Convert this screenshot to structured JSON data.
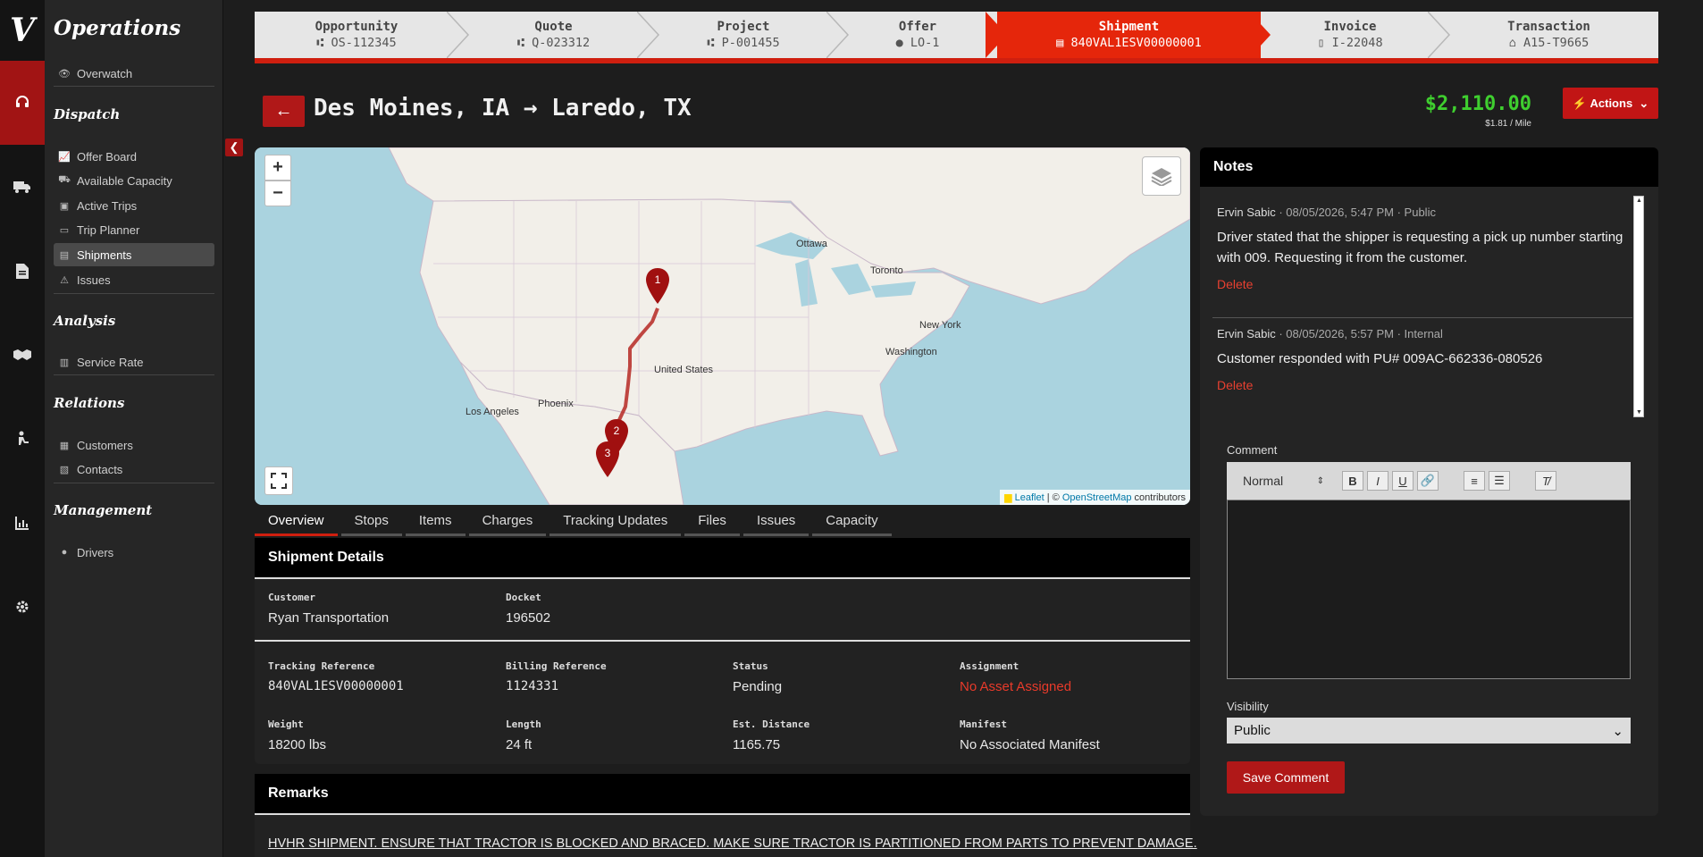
{
  "app": {
    "logo_letter": "V",
    "title": "Operations"
  },
  "rail": [
    {
      "icon": "headset-icon",
      "active": true
    },
    {
      "icon": "truck-icon",
      "active": false
    },
    {
      "icon": "document-icon",
      "active": false
    },
    {
      "icon": "handshake-icon",
      "active": false
    },
    {
      "icon": "person-carry-icon",
      "active": false
    },
    {
      "icon": "chart-icon",
      "active": false
    },
    {
      "icon": "gear-icon",
      "active": false
    }
  ],
  "nav": {
    "overwatch": "Overwatch",
    "sections": {
      "dispatch": "Dispatch",
      "analysis": "Analysis",
      "relations": "Relations",
      "management": "Management"
    },
    "items": {
      "offer_board": "Offer Board",
      "available_capacity": "Available Capacity",
      "active_trips": "Active Trips",
      "trip_planner": "Trip Planner",
      "shipments": "Shipments",
      "issues": "Issues",
      "service_rate": "Service Rate",
      "customers": "Customers",
      "contacts": "Contacts",
      "drivers": "Drivers"
    }
  },
  "breadcrumb": [
    {
      "label": "Opportunity",
      "value": "OS-112345",
      "icon": "flow-icon"
    },
    {
      "label": "Quote",
      "value": "Q-023312",
      "icon": "flow-icon"
    },
    {
      "label": "Project",
      "value": "P-001455",
      "icon": "flow-icon"
    },
    {
      "label": "Offer",
      "value": "LO-1",
      "icon": "chat-icon"
    },
    {
      "label": "Shipment",
      "value": "840VAL1ESV00000001",
      "icon": "box-icon",
      "active": true
    },
    {
      "label": "Invoice",
      "value": "I-22048",
      "icon": "document-icon"
    },
    {
      "label": "Transaction",
      "value": "A15-T9665",
      "icon": "bank-icon"
    }
  ],
  "header": {
    "back": "←",
    "route": "Des Moines, IA → Laredo, TX",
    "price": "$2,110.00",
    "per_mile": "$1.81 / Mile",
    "actions": "Actions"
  },
  "map": {
    "zoom_in": "+",
    "zoom_out": "−",
    "labels": {
      "ottawa": "Ottawa",
      "toronto": "Toronto",
      "new_york": "New York",
      "washington": "Washington",
      "united_states": "United States",
      "phoenix": "Phoenix",
      "los_angeles": "Los Angeles"
    },
    "markers": [
      "1",
      "2",
      "3"
    ],
    "attribution": {
      "leaflet": "Leaflet",
      "sep": " | © ",
      "osm": "OpenStreetMap",
      "suffix": " contributors"
    }
  },
  "tabs": [
    "Overview",
    "Stops",
    "Items",
    "Charges",
    "Tracking Updates",
    "Files",
    "Issues",
    "Capacity"
  ],
  "details": {
    "title": "Shipment Details",
    "customer": {
      "label": "Customer",
      "value": "Ryan Transportation"
    },
    "docket": {
      "label": "Docket",
      "value": "196502"
    },
    "tracking": {
      "label": "Tracking Reference",
      "value": "840VAL1ESV00000001"
    },
    "billing": {
      "label": "Billing Reference",
      "value": "1124331"
    },
    "status": {
      "label": "Status",
      "value": "Pending"
    },
    "assignment": {
      "label": "Assignment",
      "value": "No Asset Assigned"
    },
    "weight": {
      "label": "Weight",
      "value": "18200 lbs"
    },
    "length": {
      "label": "Length",
      "value": "24 ft"
    },
    "distance": {
      "label": "Est. Distance",
      "value": "1165.75"
    },
    "manifest": {
      "label": "Manifest",
      "value": "No Associated Manifest"
    }
  },
  "remarks": {
    "title": "Remarks",
    "text": "HVHR SHIPMENT. ENSURE THAT TRACTOR IS BLOCKED AND BRACED. MAKE SURE TRACTOR IS PARTITIONED FROM PARTS TO PREVENT DAMAGE."
  },
  "notes": {
    "title": "Notes",
    "items": [
      {
        "author": "Ervin Sabic",
        "meta": " · 08/05/2026, 5:47 PM · Public",
        "text": "Driver stated that the shipper is requesting a pick up number starting with 009. Requesting it from the customer.",
        "delete": "Delete"
      },
      {
        "author": "Ervin Sabic",
        "meta": " · 08/05/2026, 5:57 PM · Internal",
        "text": "Customer responded with PU# 009AC-662336-080526",
        "delete": "Delete"
      }
    ],
    "comment_label": "Comment",
    "format_select": "Normal",
    "visibility_label": "Visibility",
    "visibility_value": "Public",
    "save": "Save Comment"
  }
}
